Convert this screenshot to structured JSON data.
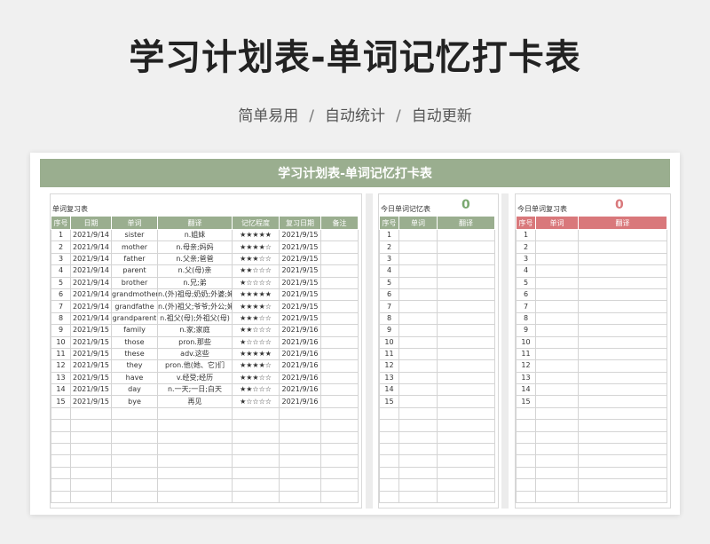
{
  "page": {
    "title": "学习计划表-单词记忆打卡表",
    "features": [
      "简单易用",
      "自动统计",
      "自动更新"
    ],
    "separator": "/"
  },
  "sheet": {
    "banner": "学习计划表-单词记忆打卡表"
  },
  "review_panel": {
    "title": "单词复习表",
    "headers": [
      "序号",
      "日期",
      "单词",
      "翻译",
      "记忆程度",
      "复习日期",
      "备注"
    ],
    "rows": [
      [
        "1",
        "2021/9/14",
        "sister",
        "n.姐妹",
        "★★★★★",
        "2021/9/15",
        ""
      ],
      [
        "2",
        "2021/9/14",
        "mother",
        "n.母亲;妈妈",
        "★★★★☆",
        "2021/9/15",
        ""
      ],
      [
        "3",
        "2021/9/14",
        "father",
        "n.父亲;爸爸",
        "★★★☆☆",
        "2021/9/15",
        ""
      ],
      [
        "4",
        "2021/9/14",
        "parent",
        "n.父(母)亲",
        "★★☆☆☆",
        "2021/9/15",
        ""
      ],
      [
        "5",
        "2021/9/14",
        "brother",
        "n.兄;弟",
        "★☆☆☆☆",
        "2021/9/15",
        ""
      ],
      [
        "6",
        "2021/9/14",
        "grandmother",
        "n.(外)祖母;奶奶;外婆;姥姥",
        "★★★★★",
        "2021/9/15",
        ""
      ],
      [
        "7",
        "2021/9/14",
        "grandfathe",
        "n.(外)祖父;爷爷;外公;姥爷",
        "★★★★☆",
        "2021/9/15",
        ""
      ],
      [
        "8",
        "2021/9/14",
        "grandparent",
        "n.祖父(母);外祖父(母)",
        "★★★☆☆",
        "2021/9/15",
        ""
      ],
      [
        "9",
        "2021/9/15",
        "family",
        "n.家;家庭",
        "★★☆☆☆",
        "2021/9/16",
        ""
      ],
      [
        "10",
        "2021/9/15",
        "those",
        "pron.那些",
        "★☆☆☆☆",
        "2021/9/16",
        ""
      ],
      [
        "11",
        "2021/9/15",
        "these",
        "adv.这些",
        "★★★★★",
        "2021/9/16",
        ""
      ],
      [
        "12",
        "2021/9/15",
        "they",
        "pron.他(她、它)们",
        "★★★★☆",
        "2021/9/16",
        ""
      ],
      [
        "13",
        "2021/9/15",
        "have",
        "v.经受;经历",
        "★★★☆☆",
        "2021/9/16",
        ""
      ],
      [
        "14",
        "2021/9/15",
        "day",
        "n.一天;一日;白天",
        "★★☆☆☆",
        "2021/9/16",
        ""
      ],
      [
        "15",
        "2021/9/15",
        "bye",
        "再见",
        "★☆☆☆☆",
        "2021/9/16",
        ""
      ]
    ],
    "empty_rows": 8
  },
  "memorize_panel": {
    "title": "今日单词记忆表",
    "count": "0",
    "count_color": "#7aa870",
    "headers": [
      "序号",
      "单词",
      "翻译"
    ],
    "row_numbers": [
      "1",
      "2",
      "3",
      "4",
      "5",
      "6",
      "7",
      "8",
      "9",
      "10",
      "11",
      "12",
      "13",
      "14",
      "15"
    ],
    "empty_rows": 8
  },
  "today_review_panel": {
    "title": "今日单词复习表",
    "count": "0",
    "count_color": "#d9787b",
    "headers": [
      "序号",
      "单词",
      "翻译"
    ],
    "row_numbers": [
      "1",
      "2",
      "3",
      "4",
      "5",
      "6",
      "7",
      "8",
      "9",
      "10",
      "11",
      "12",
      "13",
      "14",
      "15"
    ],
    "empty_rows": 8
  },
  "colors": {
    "accent_green": "#9aae8f",
    "accent_red": "#d9787b"
  }
}
